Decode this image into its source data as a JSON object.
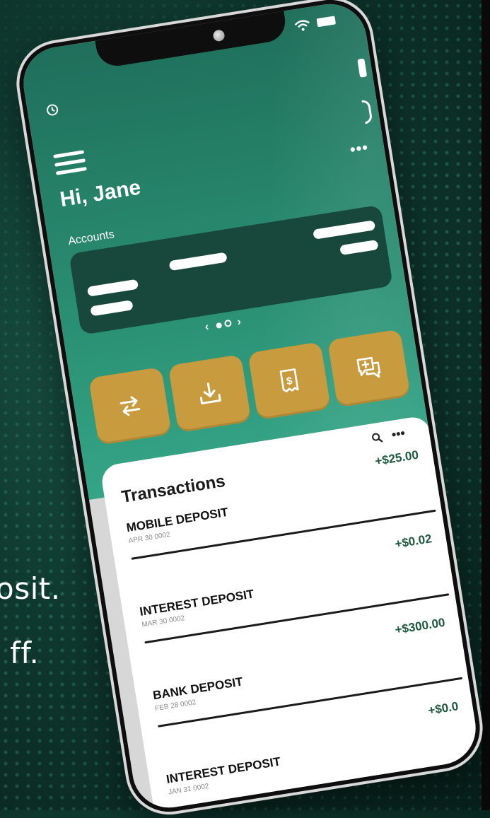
{
  "background": {
    "line_1": "osit.",
    "line_2": "ff."
  },
  "app": {
    "greeting": "Hi, Jane",
    "accounts_label": "Accounts",
    "more_menu": "•••",
    "pager": {
      "prev": "‹",
      "next": "›"
    },
    "actions": [
      {
        "name": "transfer",
        "icon": "transfer-arrows-icon"
      },
      {
        "name": "download",
        "icon": "download-tray-icon"
      },
      {
        "name": "pay-bills",
        "icon": "receipt-dollar-icon"
      },
      {
        "name": "messages",
        "icon": "chat-plus-icon"
      }
    ]
  },
  "transactions": {
    "title": "Transactions",
    "tools_more": "•••",
    "items": [
      {
        "name": "MOBILE DEPOSIT",
        "meta": "APR 30  0002",
        "amount": "+$25.00"
      },
      {
        "name": "INTEREST DEPOSIT",
        "meta": "MAR 30  0002",
        "amount": "+$0.02"
      },
      {
        "name": "BANK DEPOSIT",
        "meta": "FEB 28  0002",
        "amount": "+$300.00"
      },
      {
        "name": "INTEREST DEPOSIT",
        "meta": "JAN 31  0002",
        "amount": "+$0.0"
      }
    ]
  },
  "colors": {
    "accent_gold": "#c89b3e",
    "primary_green": "#2a8f72",
    "card_dark": "#17483b",
    "amount_green": "#1e5a3f"
  }
}
